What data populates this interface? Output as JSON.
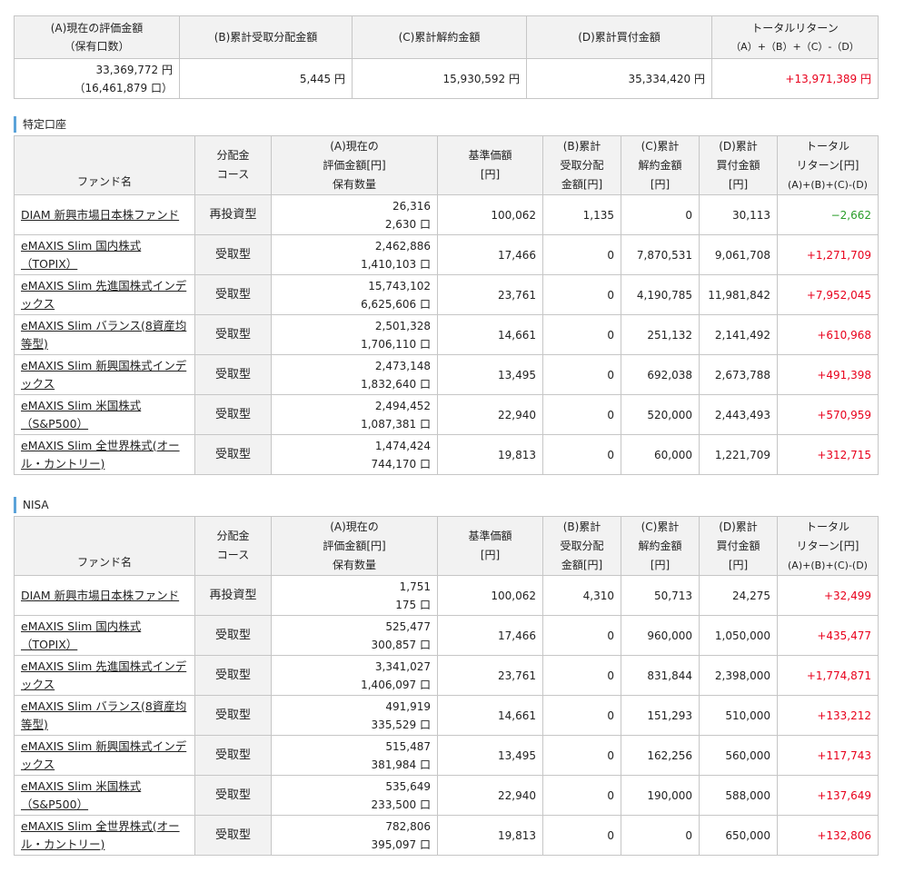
{
  "summary": {
    "headers": [
      [
        "(A)現在の評価金額",
        "（保有口数）"
      ],
      [
        "(B)累計受取分配金額"
      ],
      [
        "(C)累計解約金額"
      ],
      [
        "(D)累計買付金額"
      ],
      [
        "トータルリターン",
        "（A）+（B）+（C）-（D）"
      ]
    ],
    "values": {
      "a": "33,369,772 円",
      "a_units": "（16,461,879 口）",
      "b": "5,445 円",
      "c": "15,930,592 円",
      "d": "35,334,420 円",
      "total": "+13,971,389 円"
    }
  },
  "tokutei": {
    "title": "特定口座",
    "rows": [
      {
        "name": "DIAM 新興市場日本株ファンド",
        "course": "再投資型",
        "a": "26,316",
        "units": "2,630 口",
        "price": "100,062",
        "b": "1,135",
        "c": "0",
        "d": "30,113",
        "total": "−2,662",
        "sign": "neg"
      },
      {
        "name": "eMAXIS Slim 国内株式（TOPIX）",
        "course": "受取型",
        "a": "2,462,886",
        "units": "1,410,103 口",
        "price": "17,466",
        "b": "0",
        "c": "7,870,531",
        "d": "9,061,708",
        "total": "+1,271,709",
        "sign": "pos"
      },
      {
        "name": "eMAXIS Slim 先進国株式インデックス",
        "course": "受取型",
        "a": "15,743,102",
        "units": "6,625,606 口",
        "price": "23,761",
        "b": "0",
        "c": "4,190,785",
        "d": "11,981,842",
        "total": "+7,952,045",
        "sign": "pos"
      },
      {
        "name": "eMAXIS Slim バランス(8資産均等型)",
        "course": "受取型",
        "a": "2,501,328",
        "units": "1,706,110 口",
        "price": "14,661",
        "b": "0",
        "c": "251,132",
        "d": "2,141,492",
        "total": "+610,968",
        "sign": "pos"
      },
      {
        "name": "eMAXIS Slim 新興国株式インデックス",
        "course": "受取型",
        "a": "2,473,148",
        "units": "1,832,640 口",
        "price": "13,495",
        "b": "0",
        "c": "692,038",
        "d": "2,673,788",
        "total": "+491,398",
        "sign": "pos"
      },
      {
        "name": "eMAXIS Slim 米国株式（S&P500）",
        "course": "受取型",
        "a": "2,494,452",
        "units": "1,087,381 口",
        "price": "22,940",
        "b": "0",
        "c": "520,000",
        "d": "2,443,493",
        "total": "+570,959",
        "sign": "pos"
      },
      {
        "name": "eMAXIS Slim 全世界株式(オール・カントリー)",
        "course": "受取型",
        "a": "1,474,424",
        "units": "744,170 口",
        "price": "19,813",
        "b": "0",
        "c": "60,000",
        "d": "1,221,709",
        "total": "+312,715",
        "sign": "pos"
      }
    ]
  },
  "nisa": {
    "title": "NISA",
    "rows": [
      {
        "name": "DIAM 新興市場日本株ファンド",
        "course": "再投資型",
        "a": "1,751",
        "units": "175 口",
        "price": "100,062",
        "b": "4,310",
        "c": "50,713",
        "d": "24,275",
        "total": "+32,499",
        "sign": "pos"
      },
      {
        "name": "eMAXIS Slim 国内株式（TOPIX）",
        "course": "受取型",
        "a": "525,477",
        "units": "300,857 口",
        "price": "17,466",
        "b": "0",
        "c": "960,000",
        "d": "1,050,000",
        "total": "+435,477",
        "sign": "pos"
      },
      {
        "name": "eMAXIS Slim 先進国株式インデックス",
        "course": "受取型",
        "a": "3,341,027",
        "units": "1,406,097 口",
        "price": "23,761",
        "b": "0",
        "c": "831,844",
        "d": "2,398,000",
        "total": "+1,774,871",
        "sign": "pos"
      },
      {
        "name": "eMAXIS Slim バランス(8資産均等型)",
        "course": "受取型",
        "a": "491,919",
        "units": "335,529 口",
        "price": "14,661",
        "b": "0",
        "c": "151,293",
        "d": "510,000",
        "total": "+133,212",
        "sign": "pos"
      },
      {
        "name": "eMAXIS Slim 新興国株式インデックス",
        "course": "受取型",
        "a": "515,487",
        "units": "381,984 口",
        "price": "13,495",
        "b": "0",
        "c": "162,256",
        "d": "560,000",
        "total": "+117,743",
        "sign": "pos"
      },
      {
        "name": "eMAXIS Slim 米国株式（S&P500）",
        "course": "受取型",
        "a": "535,649",
        "units": "233,500 口",
        "price": "22,940",
        "b": "0",
        "c": "190,000",
        "d": "588,000",
        "total": "+137,649",
        "sign": "pos"
      },
      {
        "name": "eMAXIS Slim 全世界株式(オール・カントリー)",
        "course": "受取型",
        "a": "782,806",
        "units": "395,097 口",
        "price": "19,813",
        "b": "0",
        "c": "0",
        "d": "650,000",
        "total": "+132,806",
        "sign": "pos"
      }
    ]
  },
  "fund_headers": {
    "name": "ファンド名",
    "course": [
      "分配金",
      "コース"
    ],
    "a": [
      "(A)現在の",
      "評価金額[円]",
      "保有数量"
    ],
    "price": [
      "基準価額",
      "[円]"
    ],
    "b": [
      "(B)累計",
      "受取分配",
      "金額[円]"
    ],
    "c": [
      "(C)累計",
      "解約金額",
      "[円]"
    ],
    "d": [
      "(D)累計",
      "買付金額",
      "[円]"
    ],
    "total": [
      "トータル",
      "リターン[円]",
      "(A)+(B)+(C)-(D)"
    ]
  },
  "colors": {
    "positive": "#e8001c",
    "negative": "#2a9d2a",
    "accent": "#5ba3d9",
    "header_bg": "#f2f2f2"
  }
}
